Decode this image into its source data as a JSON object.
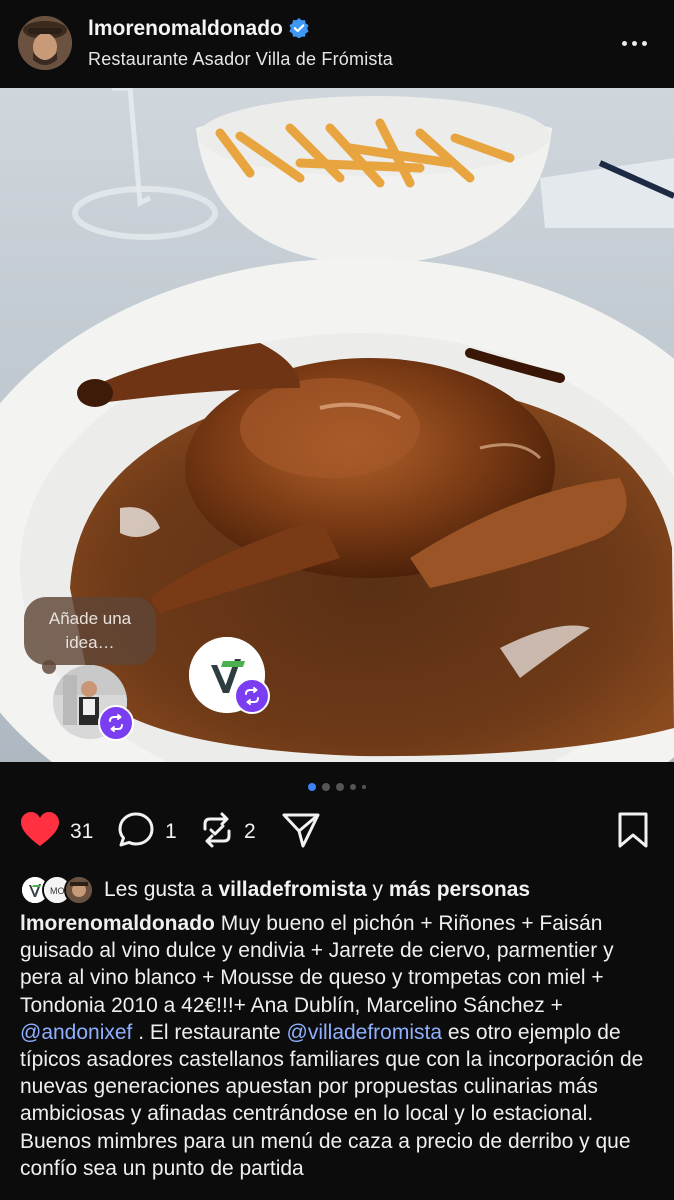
{
  "header": {
    "username": "lmorenomaldonado",
    "location": "Restaurante Asador Villa de Frómista",
    "icons": [
      "verified-badge-icon",
      "more-options-icon"
    ]
  },
  "photo": {
    "idea_bubble": "Añade una idea…",
    "carousel": {
      "total": 5,
      "active_index": 0
    }
  },
  "actions": {
    "likes": "31",
    "comments": "1",
    "reposts": "2",
    "icons": [
      "heart-icon",
      "comment-icon",
      "repost-icon",
      "share-icon",
      "bookmark-icon"
    ]
  },
  "liked_by": {
    "prefix": "Les gusta a",
    "user": "villadefromista",
    "joiner": "y",
    "others": "más personas"
  },
  "caption": {
    "author": "lmorenomaldonado",
    "text1": "Muy bueno el pichón + Riñones + Faisán guisado al vino dulce y endivia + Jarrete de ciervo, parmentier y pera al vino blanco + Mousse de queso y trompetas con miel + Tondonia 2010 a 42€!!!+ Ana Dublín, Marcelino Sánchez +",
    "mention1": "@andonixef",
    "text2": ". El restaurante",
    "mention2": "@villadefromista",
    "text3": "es otro ejemplo de típicos asadores castellanos familiares que con la incorporación de nuevas generaciones apuestan por propuestas culinarias más ambiciosas y afinadas centrándose en lo local y lo estacional. Buenos mimbres para un menú de caza a precio de derribo y que confío sea un punto de partida"
  },
  "colors": {
    "background": "#0c0c0c",
    "like_red": "#ff3040",
    "mention_blue": "#8fb0ff",
    "collab_purple": "#7a3df2",
    "carousel_active": "#3d82f6"
  }
}
